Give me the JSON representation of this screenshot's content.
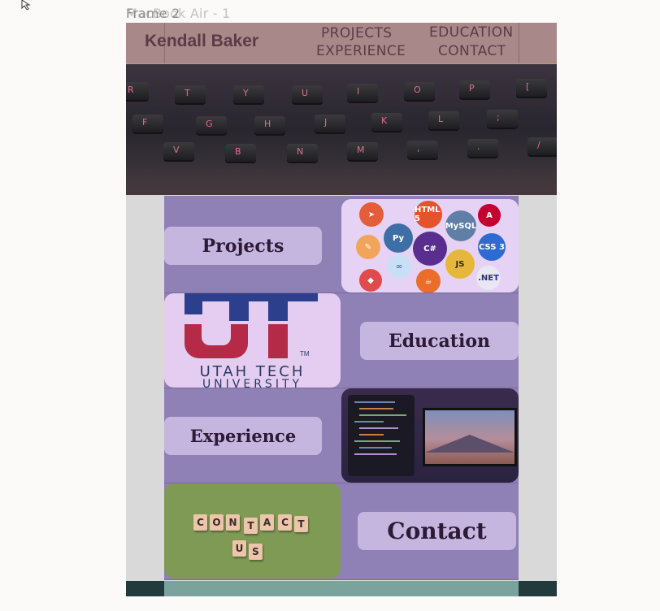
{
  "canvas": {
    "frame_label_back": "MacBook Air - 1",
    "frame_label_front": "Frame 2"
  },
  "header": {
    "brand": "Kendall Baker",
    "nav": [
      "PROJECTS",
      "EDUCATION",
      "EXPERIENCE",
      "CONTACT"
    ]
  },
  "hero": {
    "keys_row1": [
      "R",
      "T",
      "Y",
      "U",
      "I",
      "O",
      "P",
      "["
    ],
    "keys_row2": [
      "F",
      "G",
      "H",
      "J",
      "K",
      "L",
      ";"
    ],
    "keys_row3": [
      "V",
      "B",
      "N",
      "M",
      ",",
      ".",
      "/"
    ]
  },
  "sections": {
    "projects": "Projects",
    "education": "Education",
    "experience": "Experience",
    "contact": "Contact"
  },
  "skills_badges": [
    "HTML 5",
    "JS",
    "C#",
    "CSS 3",
    ".NET",
    "MySQL"
  ],
  "university": {
    "line1": "UTAH TECH",
    "line2": "UNIVERSITY",
    "mark": "TM"
  },
  "contact_tiles": {
    "row1": [
      "C",
      "O",
      "N",
      "T",
      "A",
      "C",
      "T"
    ],
    "row2": [
      "U",
      "S"
    ]
  },
  "colors": {
    "band": "#8f80b6",
    "pill": "#c5b6df",
    "header": "#a98889",
    "footer": "#233a3c"
  }
}
